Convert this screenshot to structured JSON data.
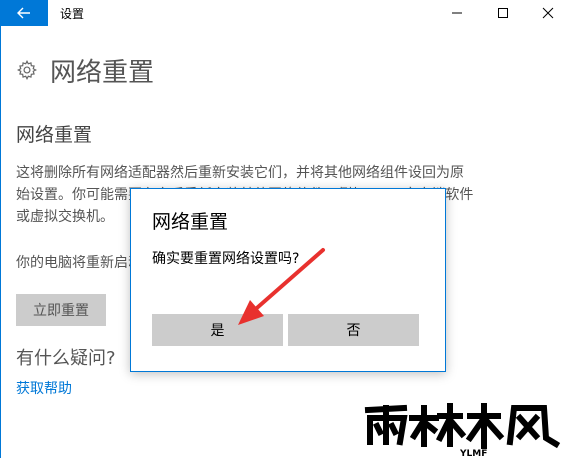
{
  "window": {
    "title": "设置",
    "accent_color": "#0078d7",
    "back_icon": "arrow-left-icon",
    "controls": [
      "minimize-icon",
      "maximize-icon",
      "close-icon"
    ]
  },
  "page": {
    "header_icon": "gear-icon",
    "title": "网络重置",
    "section_title": "网络重置",
    "description": "这将删除所有网络适配器然后重新安装它们，并将其他网络组件设回为原始设置。你可能需要在之后重新安装其他网络软件，例如 VPN 客户端软件或虚拟交换机。",
    "restart_note": "你的电脑将重新启动。",
    "reset_button": "立即重置",
    "faq_title": "有什么疑问?",
    "help_link": "获取帮助"
  },
  "dialog": {
    "title": "网络重置",
    "message": "确实要重置网络设置吗?",
    "yes_button": "是",
    "no_button": "否"
  },
  "annotation": {
    "arrow_color": "#e8312e"
  },
  "watermark": {
    "logo_text": "雨林木风",
    "sub_text": "YLMF"
  }
}
